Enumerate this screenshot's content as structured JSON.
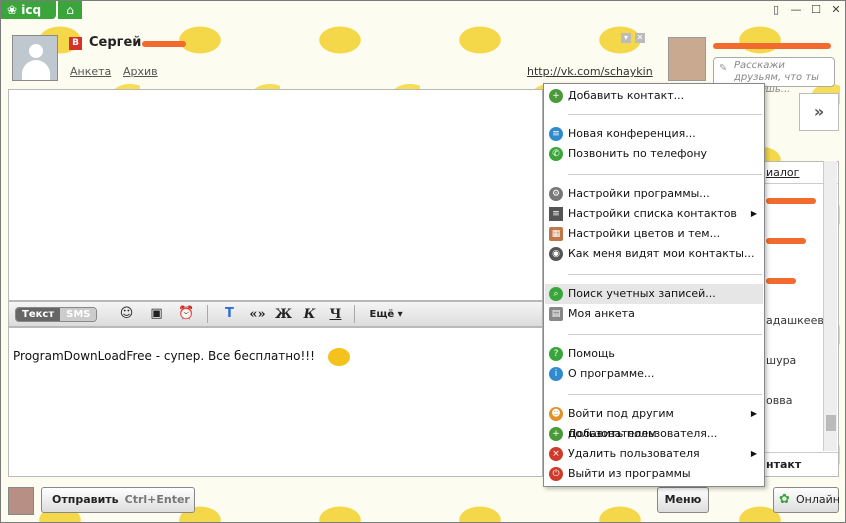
{
  "titlebar": {
    "app_name": "icq",
    "home_icon": "home-icon"
  },
  "contact": {
    "name": "Сергей",
    "network_badge": "В",
    "links": [
      "Анкета",
      "Архив"
    ],
    "url": "http://vk.com/schaykin"
  },
  "me": {
    "status_placeholder": "Расскажи друзьям, что ты делаешь..."
  },
  "toolbar": {
    "mode_text": "Текст",
    "mode_sms": "SMS",
    "format_quote": "«»",
    "format_bold": "Ж",
    "format_italic": "К",
    "format_underline": "Ч",
    "more_label": "Ещё"
  },
  "input": {
    "text": "ProgramDownLoadFree - супер. Все бесплатно!!!"
  },
  "bottom": {
    "send_label": "Отправить",
    "send_hint": "Ctrl+Enter",
    "menu_label": "Меню",
    "online_label": "Онлайн"
  },
  "right_panel": {
    "header": "иалог",
    "items": [
      "",
      "",
      "",
      "адашкеев",
      "шура",
      "овва",
      ""
    ],
    "footer": "нтакт"
  },
  "menu": {
    "items": [
      {
        "label": "Добавить контакт...",
        "icon": "add-contact-icon",
        "color": "#4a9a3a"
      },
      {
        "label": "Новая конференция...",
        "icon": "conference-icon",
        "color": "#2e8bcf"
      },
      {
        "label": "Позвонить по телефону",
        "icon": "phone-icon",
        "color": "#3aa53a"
      },
      {
        "label": "Настройки программы...",
        "icon": "gear-icon",
        "color": "#777777"
      },
      {
        "label": "Настройки списка контактов",
        "icon": "list-icon",
        "color": "#555555"
      },
      {
        "label": "Настройки цветов и тем...",
        "icon": "palette-icon",
        "color": "#c0784a"
      },
      {
        "label": "Как меня видят мои контакты...",
        "icon": "eye-icon",
        "color": "#555555"
      },
      {
        "label": "Поиск учетных записей...",
        "icon": "search-icon",
        "color": "#3aa53a"
      },
      {
        "label": "Моя анкета",
        "icon": "profile-card-icon",
        "color": "#888888"
      },
      {
        "label": "Помощь",
        "icon": "help-icon",
        "color": "#3aa53a"
      },
      {
        "label": "О программе...",
        "icon": "info-icon",
        "color": "#2e8bcf"
      },
      {
        "label": "Войти под другим пользователем",
        "icon": "switch-user-icon",
        "color": "#e0912a"
      },
      {
        "label": "Добавить пользователя...",
        "icon": "add-user-icon",
        "color": "#4a9a3a"
      },
      {
        "label": "Удалить пользователя",
        "icon": "remove-user-icon",
        "color": "#d03a2a"
      },
      {
        "label": "Выйти из программы",
        "icon": "power-icon",
        "color": "#d03a2a"
      }
    ]
  }
}
